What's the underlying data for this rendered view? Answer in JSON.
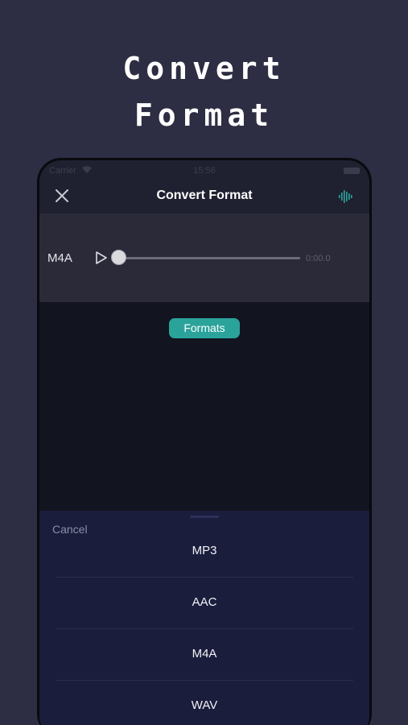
{
  "hero": {
    "line1": "Convert",
    "line2": "Format"
  },
  "status_bar": {
    "carrier": "Carrier",
    "time": "15:56"
  },
  "nav": {
    "title": "Convert Format",
    "close_icon": "close-icon",
    "right_icon": "waveform-icon"
  },
  "player": {
    "format": "M4A",
    "time": "0:00.0",
    "progress": 0.0
  },
  "formats_button": {
    "label": "Formats"
  },
  "sheet": {
    "cancel_label": "Cancel",
    "options": [
      {
        "label": "MP3"
      },
      {
        "label": "AAC"
      },
      {
        "label": "M4A"
      },
      {
        "label": "WAV"
      }
    ]
  },
  "colors": {
    "background": "#2d2d43",
    "accent": "#2aa39b",
    "sheet": "#1b1d3d",
    "player_bg": "#2a2a39",
    "content_bg": "#121420"
  }
}
